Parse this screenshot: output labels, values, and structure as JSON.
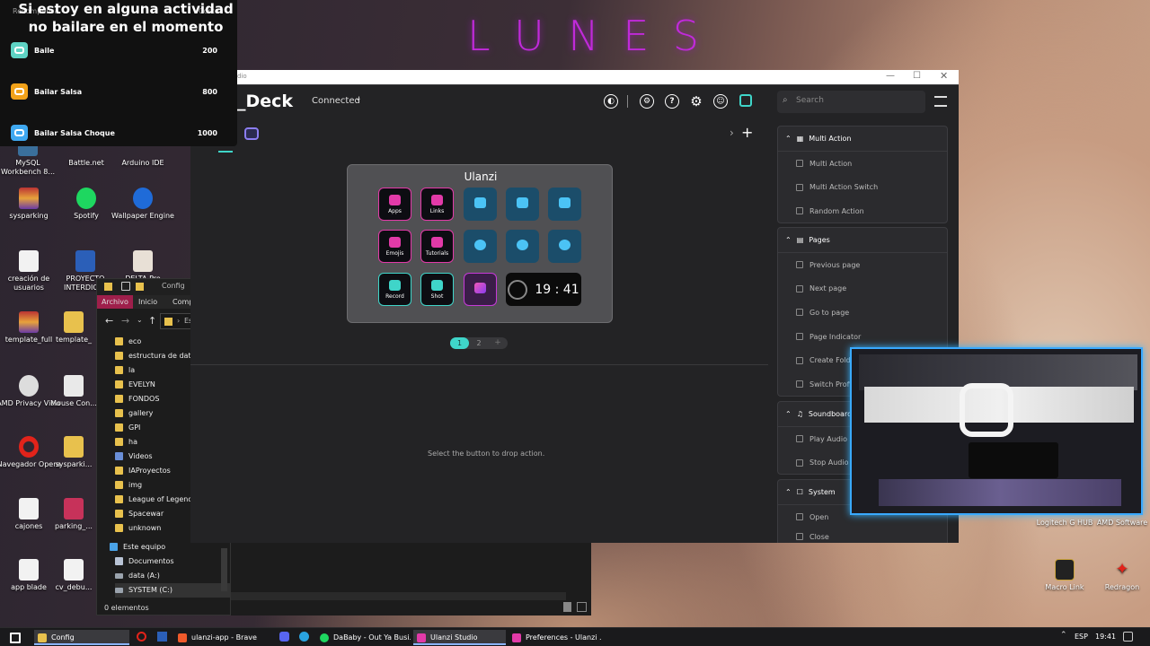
{
  "overlay": {
    "title": "Si estoy en alguna actividad no bailare en el momento",
    "header_reward": "Recompensa",
    "header_cost": "Costo",
    "rewards": [
      {
        "name": "Baile",
        "cost": "200",
        "color": "#5ed3c4"
      },
      {
        "name": "Bailar Salsa",
        "cost": "800",
        "color": "#f2a219"
      },
      {
        "name": "Bailar Salsa Choque",
        "cost": "1000",
        "color": "#3fa8f0"
      }
    ]
  },
  "wallpaper_text": [
    "L",
    "U",
    "N",
    "E",
    "S"
  ],
  "desktop": {
    "icons": [
      {
        "label": "MySQL Workbench 8...",
        "icon": "mysql-icon"
      },
      {
        "label": "Battle.net",
        "icon": "battlenet-icon"
      },
      {
        "label": "Arduino IDE",
        "icon": "arduino-icon"
      },
      {
        "label": "sysparking",
        "icon": "winrar-icon"
      },
      {
        "label": "Spotify",
        "icon": "spotify-icon"
      },
      {
        "label": "Wallpaper Engine",
        "icon": "wallpaper-engine-icon"
      },
      {
        "label": "creación de usuarios",
        "icon": "document-icon"
      },
      {
        "label": "PROYECTO INTERDICI...",
        "icon": "word-icon"
      },
      {
        "label": "DELTA Pro",
        "icon": "document-icon"
      },
      {
        "label": "template_full",
        "icon": "winrar-icon"
      },
      {
        "label": "template_",
        "icon": "folder-icon"
      },
      {
        "label": "AMD Privacy View",
        "icon": "amd-icon"
      },
      {
        "label": "Mouse Con...",
        "icon": "mouse-icon"
      },
      {
        "label": "Navegador Opera",
        "icon": "opera-icon"
      },
      {
        "label": "sysparki...",
        "icon": "folder-icon"
      },
      {
        "label": "cajones",
        "icon": "document-icon"
      },
      {
        "label": "parking_...",
        "icon": "database-icon"
      },
      {
        "label": "app blade",
        "icon": "document-icon"
      },
      {
        "label": "cv_debu...",
        "icon": "document-icon"
      },
      {
        "label": "Logitech G HUB",
        "icon": "logitech-icon"
      },
      {
        "label": "AMD Software",
        "icon": "amd-icon"
      },
      {
        "label": "Macro Link",
        "icon": "macro-link-icon"
      },
      {
        "label": "Redragon",
        "icon": "redragon-icon"
      }
    ]
  },
  "explorer": {
    "title": "Config",
    "tabs": [
      "Archivo",
      "Inicio",
      "Compa"
    ],
    "address": "Este",
    "folders": [
      "eco",
      "estructura de datos",
      "la",
      "EVELYN",
      "FONDOS",
      "gallery",
      "GPI",
      "ha",
      "Videos",
      "IAProyectos",
      "img",
      "League of Legends",
      "Spacewar",
      "unknown"
    ],
    "this_pc": "Este equipo",
    "drives": [
      "Documentos",
      "data (A:)",
      "SYSTEM (C:)"
    ],
    "status": "0 elementos"
  },
  "studio": {
    "window_title": "dio",
    "app_title": "_Deck",
    "connection": "Connected",
    "device_name": "Ulanzi",
    "keys": [
      {
        "label": "Apps",
        "color": "#e23aa8"
      },
      {
        "label": "Links",
        "color": "#e23aa8"
      },
      {
        "label": "",
        "color": "#4bc3f5"
      },
      {
        "label": "",
        "color": "#4bc3f5"
      },
      {
        "label": "",
        "color": "#4bc3f5"
      },
      {
        "label": "Emojis",
        "color": "#e23aa8"
      },
      {
        "label": "Tutorials",
        "color": "#e23aa8"
      },
      {
        "label": "",
        "color": "#4bc3f5"
      },
      {
        "label": "",
        "color": "#4bc3f5"
      },
      {
        "label": "",
        "color": "#4bc3f5"
      },
      {
        "label": "Record",
        "color": "#3fd5c9"
      },
      {
        "label": "Shot",
        "color": "#3fd5c9"
      },
      {
        "label": "",
        "color": "#c63ad8"
      }
    ],
    "clock": "19 : 41",
    "pages": [
      "1",
      "2",
      "+"
    ],
    "drop_hint": "Select the button to drop action.",
    "search_placeholder": "Search",
    "sections": [
      {
        "title": "Multi Action",
        "items": [
          "Multi Action",
          "Multi Action Switch",
          "Random Action"
        ]
      },
      {
        "title": "Pages",
        "items": [
          "Previous page",
          "Next page",
          "Go to page",
          "Page Indicator",
          "Create Folder",
          "Switch Profile"
        ]
      },
      {
        "title": "Soundboard",
        "items": [
          "Play Audio",
          "Stop Audio"
        ]
      },
      {
        "title": "System",
        "items": [
          "Open",
          "Close"
        ]
      }
    ]
  },
  "taskbar": {
    "items": [
      {
        "label": "Config",
        "color": "#e8c14d"
      },
      {
        "label": "ulanzi-app - Brave",
        "color": "#f05a2b"
      },
      {
        "label": "DaBaby - Out Ya Busi...",
        "color": "#1ed760"
      },
      {
        "label": "Ulanzi Studio",
        "color": "#e23aa8"
      },
      {
        "label": "Preferences - Ulanzi ...",
        "color": "#e23aa8"
      }
    ],
    "lang": "ESP",
    "time": "19:41"
  }
}
